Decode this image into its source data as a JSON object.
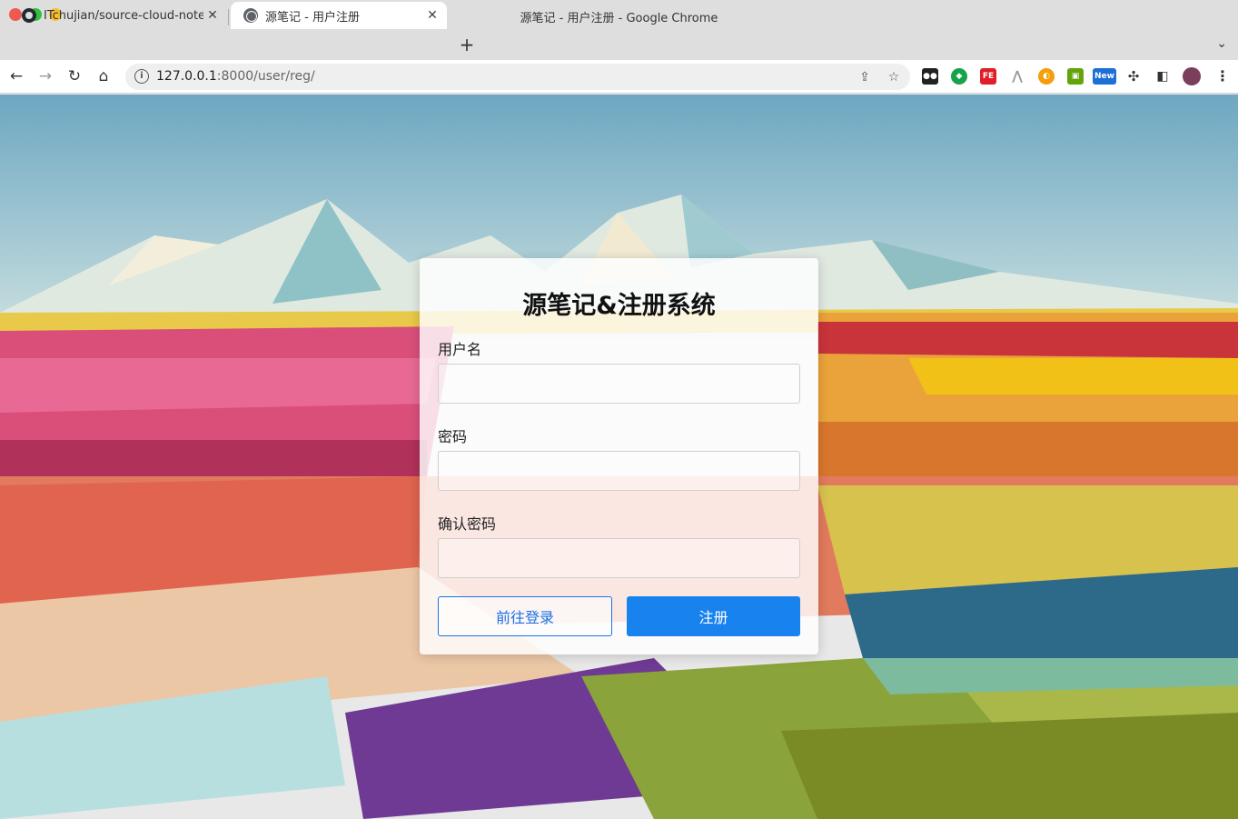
{
  "window": {
    "title": "源笔记 - 用户注册 - Google Chrome"
  },
  "tabs": [
    {
      "label": "ITchujian/source-cloud-note",
      "active": false,
      "icon": "github-icon"
    },
    {
      "label": "源笔记 - 用户注册",
      "active": true,
      "icon": "globe-icon"
    }
  ],
  "toolbar": {
    "url_host": "127.0.0.1",
    "url_rest": ":8000/user/reg/",
    "extension_badge": "New",
    "extension_ext_label": "FE"
  },
  "page": {
    "title": "源笔记&注册系统",
    "username_label": "用户名",
    "username_value": "",
    "password_label": "密码",
    "password_value": "",
    "confirm_label": "确认密码",
    "confirm_value": "",
    "login_button": "前往登录",
    "register_button": "注册"
  },
  "colors": {
    "primary": "#1883ef",
    "link": "#1a73e8"
  }
}
